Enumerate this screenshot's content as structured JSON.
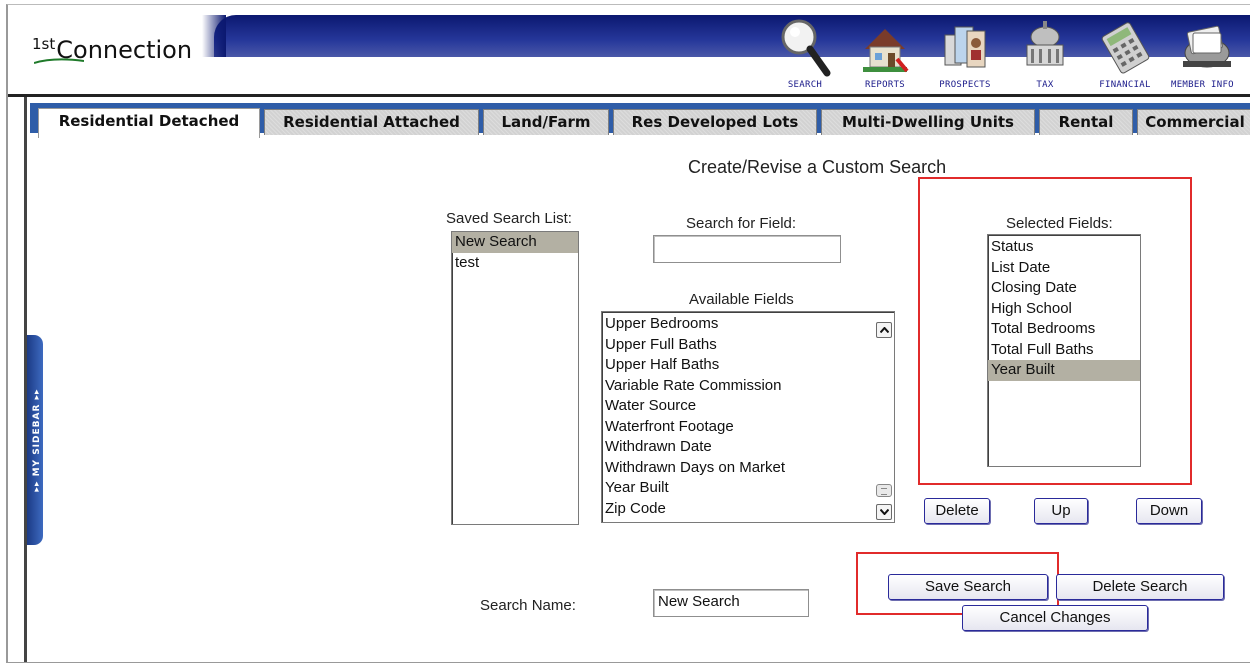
{
  "header": {
    "logo_super": "1st",
    "logo_text": "Connection",
    "nav": [
      {
        "label": "SEARCH",
        "icon": "magnifier-icon"
      },
      {
        "label": "REPORTS",
        "icon": "house-report-icon"
      },
      {
        "label": "PROSPECTS",
        "icon": "prospects-icon"
      },
      {
        "label": "TAX",
        "icon": "capitol-icon"
      },
      {
        "label": "FINANCIAL",
        "icon": "calculator-icon"
      },
      {
        "label": "MEMBER INFO",
        "icon": "rolodex-icon"
      }
    ]
  },
  "tabs": [
    {
      "label": "Residential Detached",
      "active": true
    },
    {
      "label": "Residential Attached",
      "active": false
    },
    {
      "label": "Land/Farm",
      "active": false
    },
    {
      "label": "Res Developed Lots",
      "active": false
    },
    {
      "label": "Multi-Dwelling Units",
      "active": false
    },
    {
      "label": "Rental",
      "active": false
    },
    {
      "label": "Commercial",
      "active": false
    }
  ],
  "sidebar": {
    "label": "▸▸ MY SIDEBAR ▸▸"
  },
  "page": {
    "title": "Create/Revise a Custom Search",
    "saved_search_list": {
      "label": "Saved Search List:",
      "items": [
        "New Search",
        "test"
      ],
      "selected": "New Search"
    },
    "search_field": {
      "label": "Search for Field:",
      "value": ""
    },
    "available_fields": {
      "label": "Available Fields",
      "items": [
        "Upper Bedrooms",
        "Upper Full Baths",
        "Upper Half Baths",
        "Variable Rate Commission",
        "Water Source",
        "Waterfront Footage",
        "Withdrawn Date",
        "Withdrawn Days on Market",
        "Year Built",
        "Zip Code"
      ]
    },
    "selected_fields": {
      "label": "Selected Fields:",
      "items": [
        "Status",
        "List Date",
        "Closing Date",
        "High School",
        "Total Bedrooms",
        "Total Full Baths",
        "Year Built"
      ],
      "selected": "Year Built"
    },
    "field_buttons": {
      "delete": "Delete",
      "up": "Up",
      "down": "Down"
    },
    "search_name": {
      "label": "Search Name:",
      "value": "New Search"
    },
    "action_buttons": {
      "save": "Save Search",
      "delete_search": "Delete Search",
      "cancel": "Cancel Changes"
    }
  },
  "colors": {
    "tab_band": "#2f5da8",
    "header_band": "#0b1870",
    "highlight": "#e12b2b",
    "selection": "#b3b0a3"
  }
}
